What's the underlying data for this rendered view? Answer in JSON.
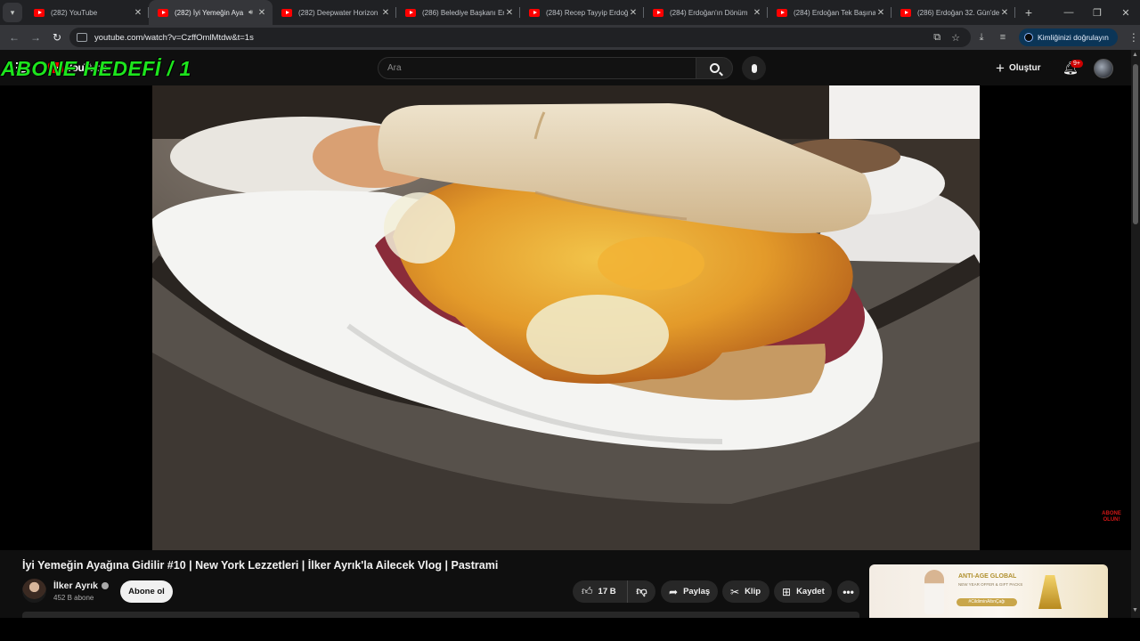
{
  "browser": {
    "tabs": [
      {
        "title": "(282) YouTube",
        "active": false,
        "audio": false
      },
      {
        "title": "(282) İyi Yemeğin Aya",
        "active": true,
        "audio": true
      },
      {
        "title": "(282) Deepwater Horizon",
        "active": false,
        "audio": false
      },
      {
        "title": "(286) Belediye Başkanı Er",
        "active": false,
        "audio": false
      },
      {
        "title": "(284) Recep Tayyip Erdoğ",
        "active": false,
        "audio": false
      },
      {
        "title": "(284) Erdoğan'ın Dönüm",
        "active": false,
        "audio": false
      },
      {
        "title": "(284) Erdoğan Tek Başına",
        "active": false,
        "audio": false
      },
      {
        "title": "(286) Erdoğan 32. Gün'de",
        "active": false,
        "audio": false
      }
    ],
    "url": "youtube.com/watch?v=CzffOmlMtdw&t=1s",
    "verify_label": "Kimliğinizi doğrulayın"
  },
  "youtube": {
    "logo_text": "YouTube",
    "overlay_text": "ABONE HEDEFİ / 1",
    "search_placeholder": "Ara",
    "create_label": "Oluştur",
    "notification_count": "9+"
  },
  "video": {
    "title": "İyi Yemeğin Ayağına Gidilir #10 | New York Lezzetleri | İlker Ayrık'la Ailecek Vlog | Pastrami",
    "watermark": "ABONE OLUN!",
    "channel_name": "İlker Ayrık",
    "subscriber_count": "452 B abone",
    "subscribe_label": "Abone ol",
    "like_count": "17 B",
    "share_label": "Paylaş",
    "clip_label": "Klip",
    "save_label": "Kaydet"
  },
  "ad": {
    "headline": "ANTI-AGE GLOBAL",
    "subtext": "NEW YEAR OFFER & GIFT PACKS",
    "hashtag": "#CildiminAltınÇağı"
  },
  "colors": {
    "youtube_red": "#ff0000",
    "overlay_green": "#1de51d",
    "background": "#0f0f0f"
  }
}
